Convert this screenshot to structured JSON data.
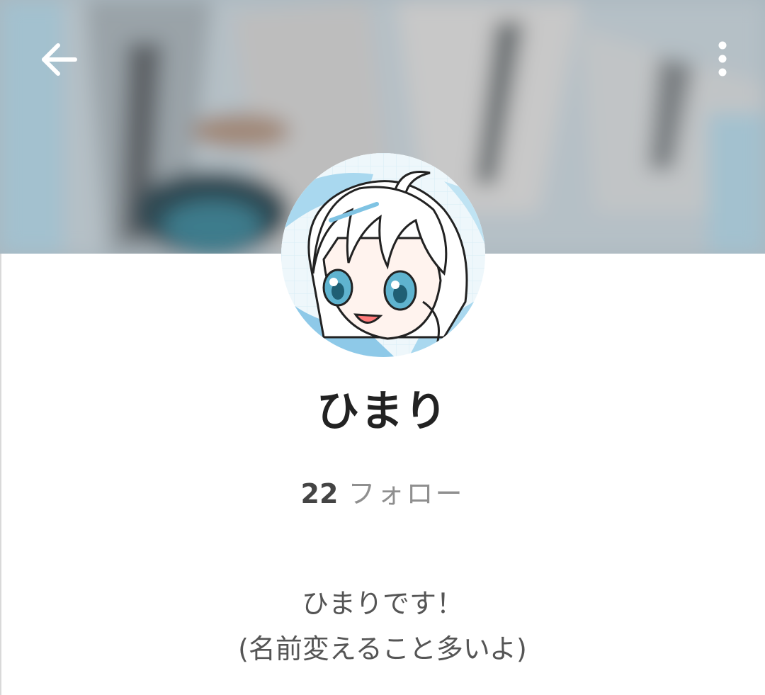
{
  "profile": {
    "username": "ひまり",
    "follow_count": "22",
    "follow_label": "フォロー",
    "bio_lines": [
      "ひまりです！",
      "(名前変えること多いよ)"
    ]
  },
  "toolbar": {
    "back_icon": "back-arrow-icon",
    "more_icon": "more-vert-icon"
  },
  "colors": {
    "banner": "#aebbc3",
    "text_primary": "#222222",
    "text_secondary": "#8f8f8f",
    "avatar_accent": "#8ec9e8"
  }
}
